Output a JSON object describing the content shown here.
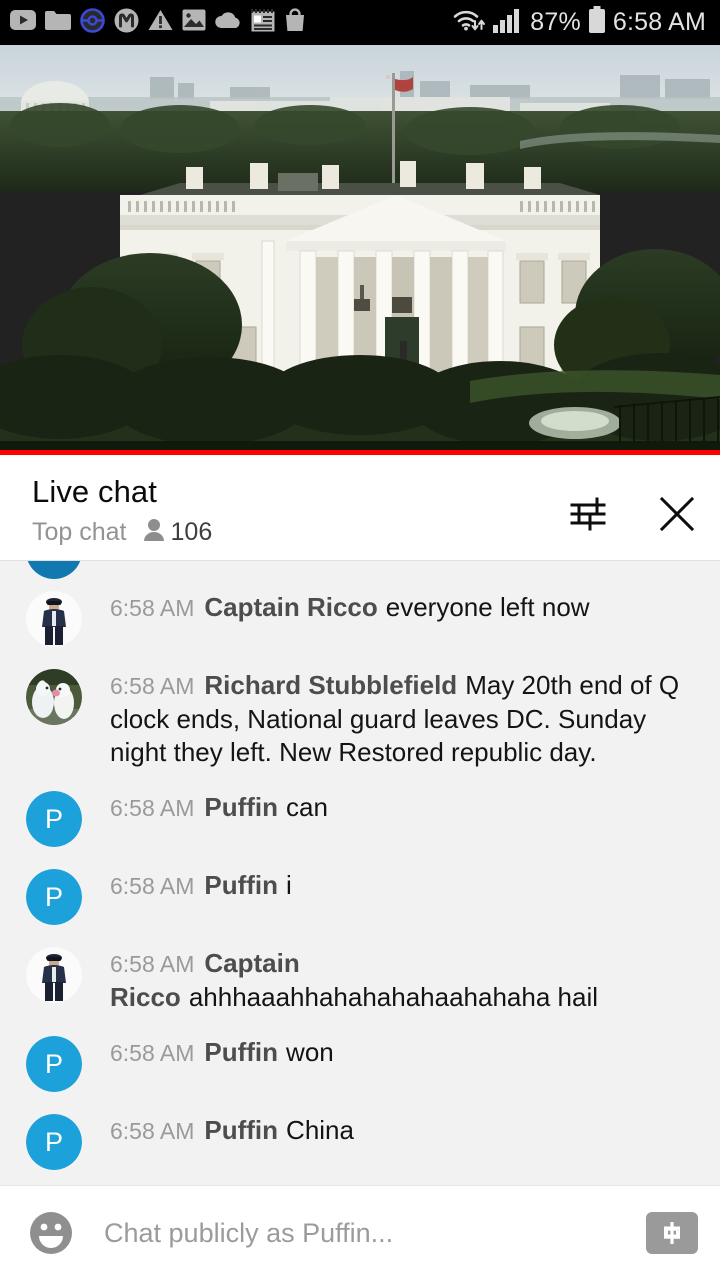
{
  "statusbar": {
    "icons": [
      {
        "name": "youtube-icon"
      },
      {
        "name": "folder-icon"
      },
      {
        "name": "pokemon-go-icon"
      },
      {
        "name": "messenger-m-icon"
      },
      {
        "name": "warning-triangle-icon"
      },
      {
        "name": "photo-icon"
      },
      {
        "name": "cloud-icon"
      },
      {
        "name": "news-icon"
      },
      {
        "name": "shopping-bag-icon"
      }
    ],
    "wifi_icon": "wifi-icon",
    "signal_icon": "cellular-signal-icon",
    "battery_percent": "87%",
    "battery_icon": "battery-icon",
    "clock": "6:58 AM"
  },
  "video": {
    "name": "white-house-live-stream",
    "progress_percent": 100,
    "progress_color": "#ff0000"
  },
  "chat_header": {
    "title": "Live chat",
    "mode": "Top chat",
    "viewer_icon": "person-icon",
    "viewer_count": "106",
    "settings_icon": "chat-settings-icon",
    "close_icon": "close-icon"
  },
  "messages": [
    {
      "id": "m1",
      "avatar_type": "image",
      "avatar_kind": "police-officer-photo",
      "timestamp": "6:58 AM",
      "author": "Captain Ricco",
      "text": "everyone left now",
      "inline": true
    },
    {
      "id": "m2",
      "avatar_type": "image",
      "avatar_kind": "white-birds-photo",
      "timestamp": "6:58 AM",
      "author": "Richard Stubblefield",
      "text": "May 20th end of Q clock ends, National guard leaves DC. Sunday night they left. New Restored republic day.",
      "inline": true
    },
    {
      "id": "m3",
      "avatar_type": "initial",
      "avatar_initial": "P",
      "avatar_color": "#1da1da",
      "timestamp": "6:58 AM",
      "author": "Puffin",
      "text": "can",
      "inline": true
    },
    {
      "id": "m4",
      "avatar_type": "initial",
      "avatar_initial": "P",
      "avatar_color": "#1da1da",
      "timestamp": "6:58 AM",
      "author": "Puffin",
      "text": "i",
      "inline": true
    },
    {
      "id": "m5",
      "avatar_type": "image",
      "avatar_kind": "police-officer-photo",
      "timestamp": "6:58 AM",
      "author": "Captain Ricco",
      "text": "ahhhaaahhahahahahaahahaha hail",
      "inline": false
    },
    {
      "id": "m6",
      "avatar_type": "initial",
      "avatar_initial": "P",
      "avatar_color": "#1da1da",
      "timestamp": "6:58 AM",
      "author": "Puffin",
      "text": "won",
      "inline": true
    },
    {
      "id": "m7",
      "avatar_type": "initial",
      "avatar_initial": "P",
      "avatar_color": "#1da1da",
      "timestamp": "6:58 AM",
      "author": "Puffin",
      "text": "China",
      "inline": true
    }
  ],
  "input_bar": {
    "emoji_icon": "emoji-smiley-icon",
    "placeholder": "Chat publicly as Puffin...",
    "value": "",
    "superchat_icon": "dollar-superchat-icon"
  },
  "colors": {
    "accent_red": "#ff0000",
    "avatar_blue": "#1da1da",
    "chat_bg": "#f2f2f2",
    "statusbar_bg": "#000000"
  }
}
